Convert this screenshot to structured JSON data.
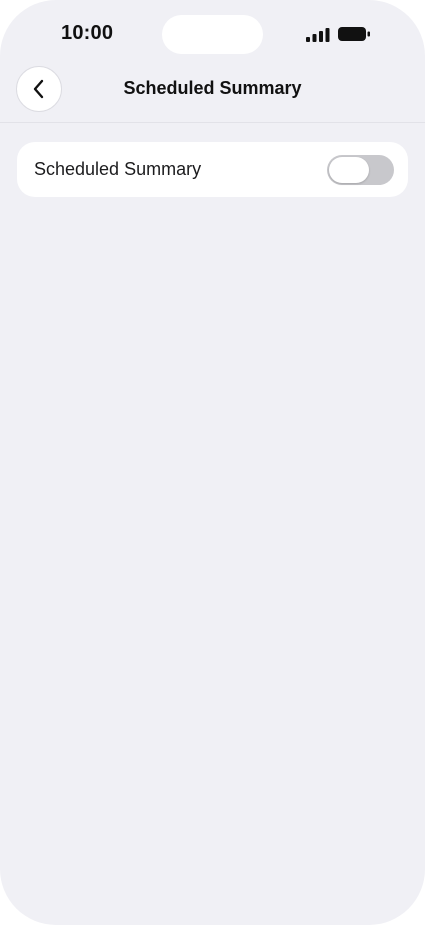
{
  "status_bar": {
    "time": "10:00",
    "signal_icon": "cellular-signal-icon",
    "battery_icon": "battery-icon"
  },
  "nav": {
    "back_icon": "chevron-left-icon",
    "title": "Scheduled Summary"
  },
  "settings": {
    "rows": [
      {
        "label": "Scheduled Summary",
        "toggle_on": false
      }
    ]
  },
  "colors": {
    "background": "#f0f0f5",
    "card": "#ffffff",
    "toggle_off_track": "#c8c8cc",
    "text_primary": "#111111"
  }
}
